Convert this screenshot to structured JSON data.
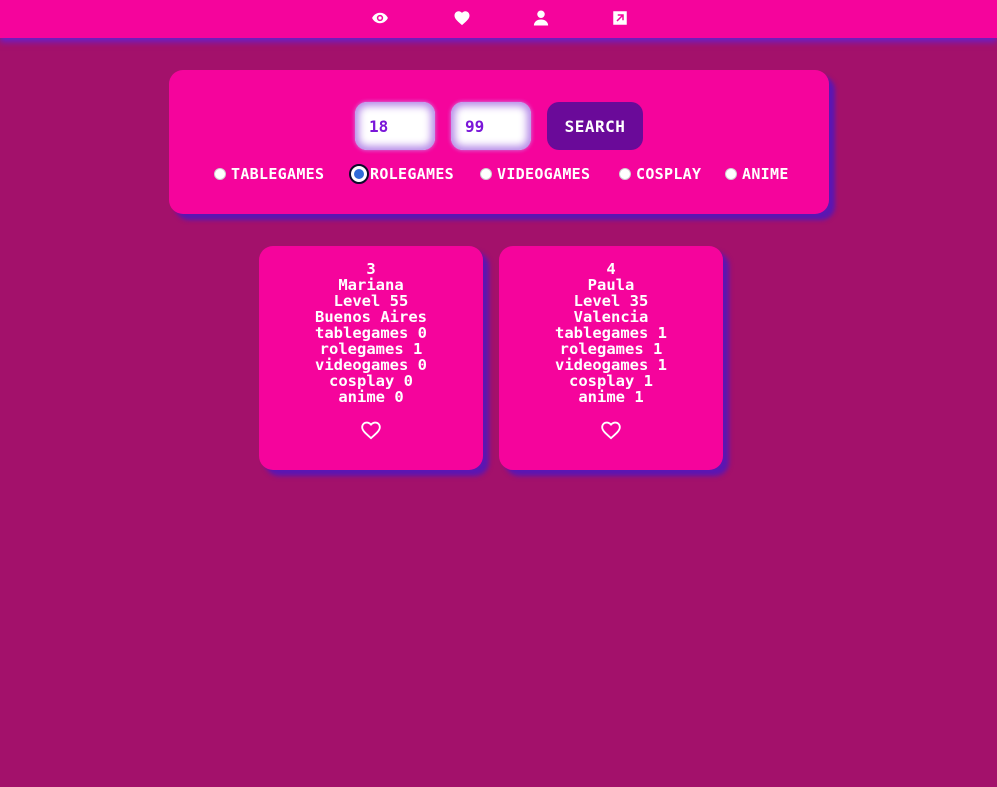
{
  "nav": {
    "icons": [
      "eye-icon",
      "heart-icon",
      "user-icon",
      "external-link-icon"
    ]
  },
  "search": {
    "min_age": "18",
    "max_age": "99",
    "button_label": "SEARCH",
    "categories": [
      {
        "label": "TABLEGAMES",
        "selected": false
      },
      {
        "label": "ROLEGAMES",
        "selected": true
      },
      {
        "label": "VIDEOGAMES",
        "selected": false
      },
      {
        "label": "COSPLAY",
        "selected": false
      },
      {
        "label": "ANIME",
        "selected": false
      }
    ]
  },
  "results": [
    {
      "id": "3",
      "name": "Mariana",
      "level": "Level 55",
      "city": "Buenos Aires",
      "tablegames": "tablegames 0",
      "rolegames": "rolegames 1",
      "videogames": "videogames 0",
      "cosplay": "cosplay 0",
      "anime": "anime 0"
    },
    {
      "id": "4",
      "name": "Paula",
      "level": "Level 35",
      "city": "Valencia",
      "tablegames": "tablegames 1",
      "rolegames": "rolegames 1",
      "videogames": "videogames 1",
      "cosplay": "cosplay 1",
      "anime": "anime 1"
    }
  ],
  "colors": {
    "background": "#a3116b",
    "primary": "#f5049c",
    "accent": "#6a0a99",
    "shadow": "#5b16b3"
  }
}
